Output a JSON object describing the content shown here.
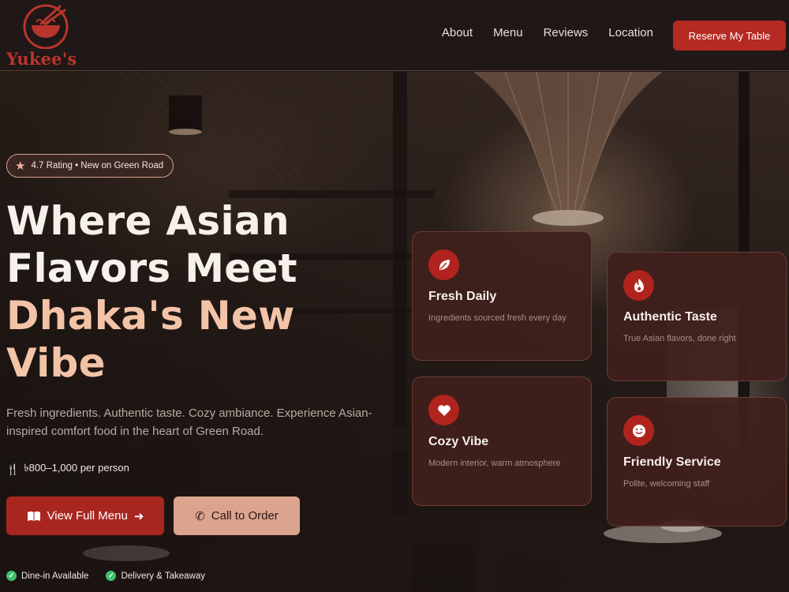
{
  "brand": {
    "name": "Yukee's"
  },
  "nav": {
    "links": [
      "About",
      "Menu",
      "Reviews",
      "Location"
    ],
    "cta": "Reserve My Table"
  },
  "hero": {
    "badge": "4.7 Rating • New on Green Road",
    "headline_line1": "Where Asian",
    "headline_line2": "Flavors Meet",
    "headline_accent1": "Dhaka's New",
    "headline_accent2": "Vibe",
    "subtext": "Fresh ingredients. Authentic taste. Cozy ambiance. Experience Asian-inspired comfort food in the heart of Green Road.",
    "price": "৳800–1,000 per person",
    "primary_button": "View Full Menu",
    "secondary_button": "Call to Order",
    "features": [
      "Dine-in Available",
      "Delivery & Takeaway"
    ]
  },
  "cards": [
    {
      "title": "Fresh Daily",
      "description": "Ingredients sourced fresh every day",
      "icon": "leaf-icon"
    },
    {
      "title": "Authentic Taste",
      "description": "True Asian flavors, done right",
      "icon": "fire-icon"
    },
    {
      "title": "Cozy Vibe",
      "description": "Modern interior, warm atmosphere",
      "icon": "heart-icon"
    },
    {
      "title": "Friendly Service",
      "description": "Polite, welcoming staff",
      "icon": "smile-icon"
    }
  ],
  "colors": {
    "accent": "#b52a22",
    "accent_light": "#f3c3a8",
    "button_secondary": "#dca48e",
    "card_bg": "#401f1c",
    "check_green": "#3fbf6b"
  }
}
